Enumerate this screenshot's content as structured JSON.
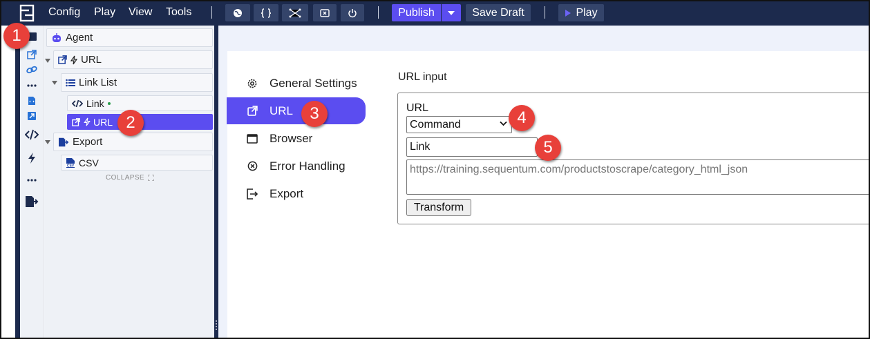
{
  "menu": {
    "config": "Config",
    "play": "Play",
    "view": "View",
    "tools": "Tools"
  },
  "toolbar": {
    "icons": [
      "globe-icon",
      "braces-icon",
      "network-icon",
      "close-box-icon",
      "power-icon"
    ],
    "publish_label": "Publish",
    "save_draft_label": "Save Draft",
    "play_label": "Play"
  },
  "tree": {
    "agent": "Agent",
    "url_parent": "URL",
    "link_list": "Link List",
    "link": "Link",
    "url_selected": "URL",
    "export": "Export",
    "csv": "CSV",
    "collapse": "COLLAPSE"
  },
  "settings_nav": {
    "general": "General Settings",
    "url": "URL",
    "browser": "Browser",
    "error_handling": "Error Handling",
    "export": "Export"
  },
  "url_input": {
    "section_title": "URL input",
    "field_label": "URL",
    "command_value": "Command",
    "link_value": "Link",
    "url_text": "https://training.sequentum.com/productstoscrape/category_html_json",
    "transform_label": "Transform"
  },
  "callouts": [
    "1",
    "2",
    "3",
    "4",
    "5"
  ],
  "colors": {
    "topbar": "#1c2a4d",
    "accent": "#5b4df0",
    "callout": "#e8403a",
    "panel": "#eef1f6"
  }
}
